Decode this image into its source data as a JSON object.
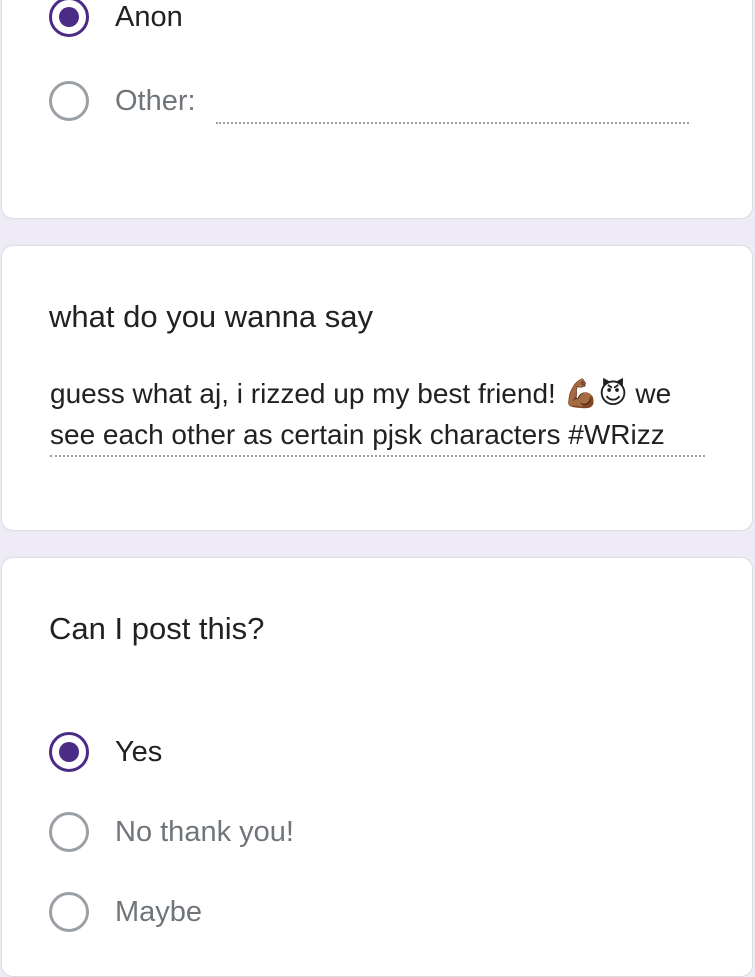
{
  "identity_question": {
    "options": [
      {
        "label": "Anon",
        "selected": true
      },
      {
        "label": "Other:",
        "selected": false
      }
    ],
    "other_value": ""
  },
  "message_question": {
    "title": "what do you wanna say",
    "answer": "guess what aj, i rizzed up my best friend! 💪🏾😈 we see each other as certain pjsk characters #WRizz"
  },
  "post_question": {
    "title": "Can I post this?",
    "options": [
      {
        "label": "Yes",
        "selected": true
      },
      {
        "label": "No thank you!",
        "selected": false
      },
      {
        "label": "Maybe",
        "selected": false
      }
    ]
  },
  "colors": {
    "accent": "#4a2b86",
    "background": "#efebf6",
    "card": "#ffffff",
    "unselected_radio": "#9aa0a6"
  }
}
